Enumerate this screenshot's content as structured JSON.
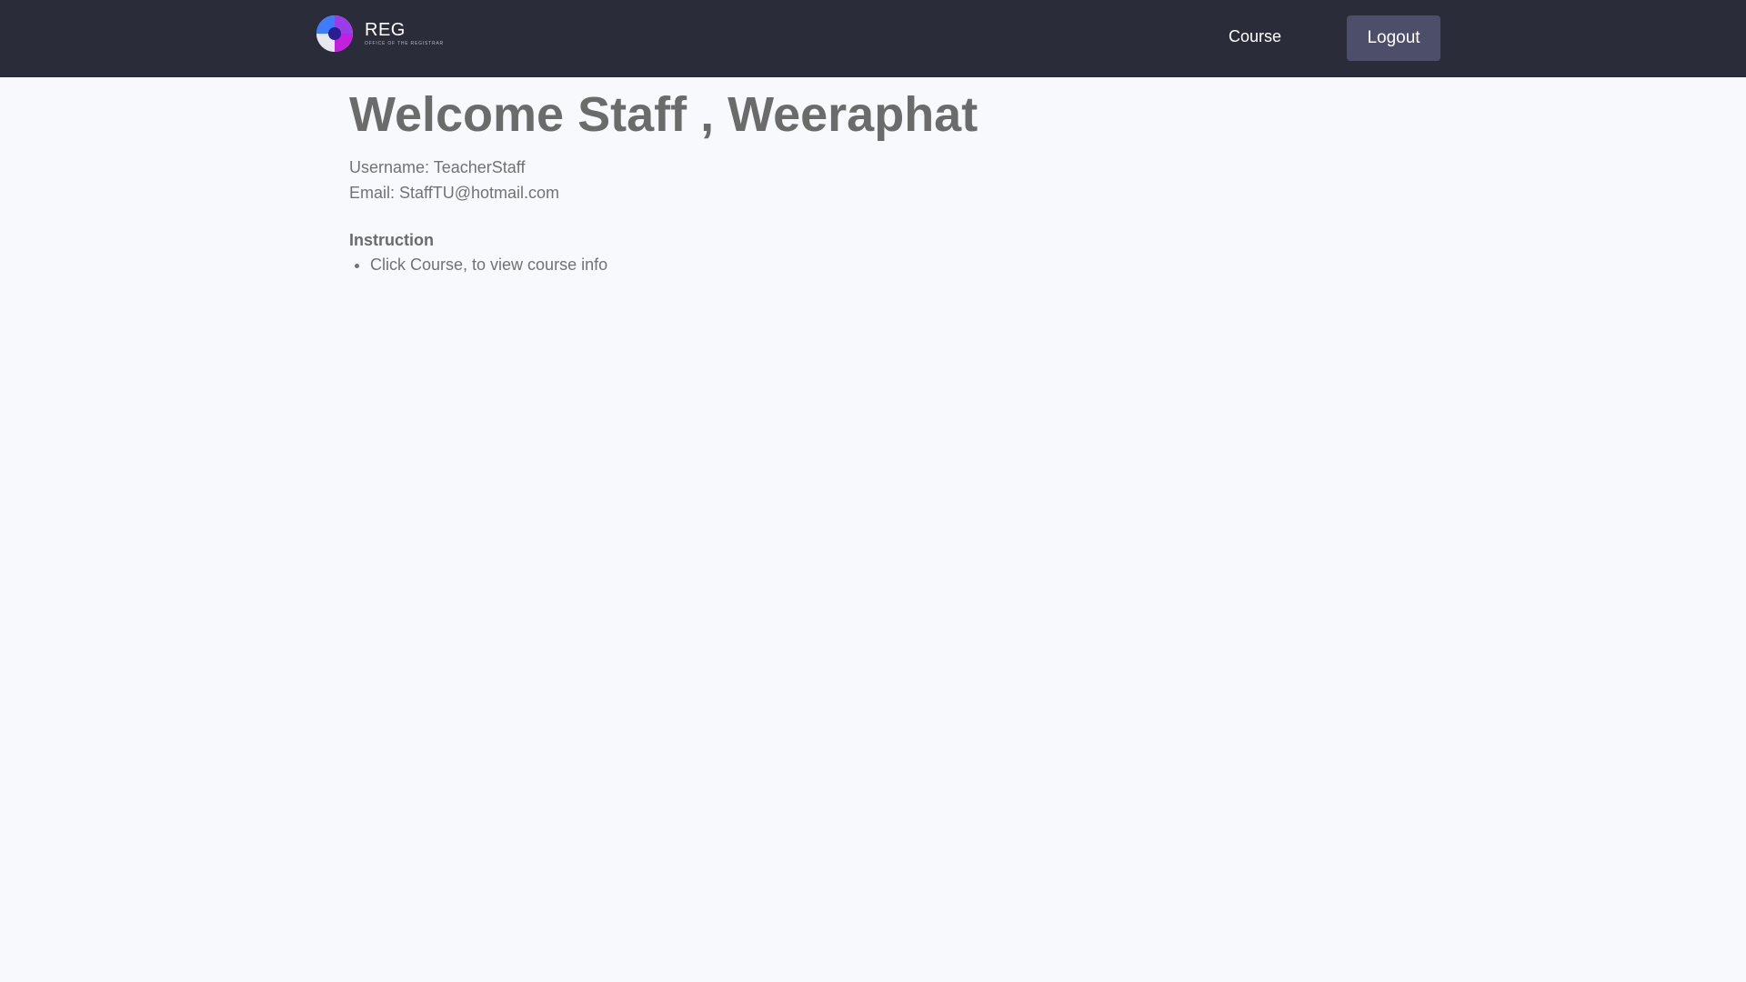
{
  "header": {
    "logo_title": "REG",
    "logo_subtitle": "OFFICE OF THE REGISTRAR",
    "logo_icon": "registrar-logo-icon",
    "nav_course_label": "Course",
    "logout_label": "Logout"
  },
  "main": {
    "welcome_title": "Welcome Staff , Weeraphat",
    "username_line": "Username: TeacherStaff",
    "email_line": "Email: StaffTU@hotmail.com",
    "instruction_heading": "Instruction",
    "instructions": [
      "Click Course, to view course info"
    ]
  },
  "colors": {
    "navbar_bg": "#2b2c39",
    "logout_bg": "#4d4e6a",
    "page_bg": "#f8f9fc",
    "text": "#6d6d6d",
    "logo_blue": "#3d7bff",
    "logo_magenta": "#c21fe0"
  }
}
